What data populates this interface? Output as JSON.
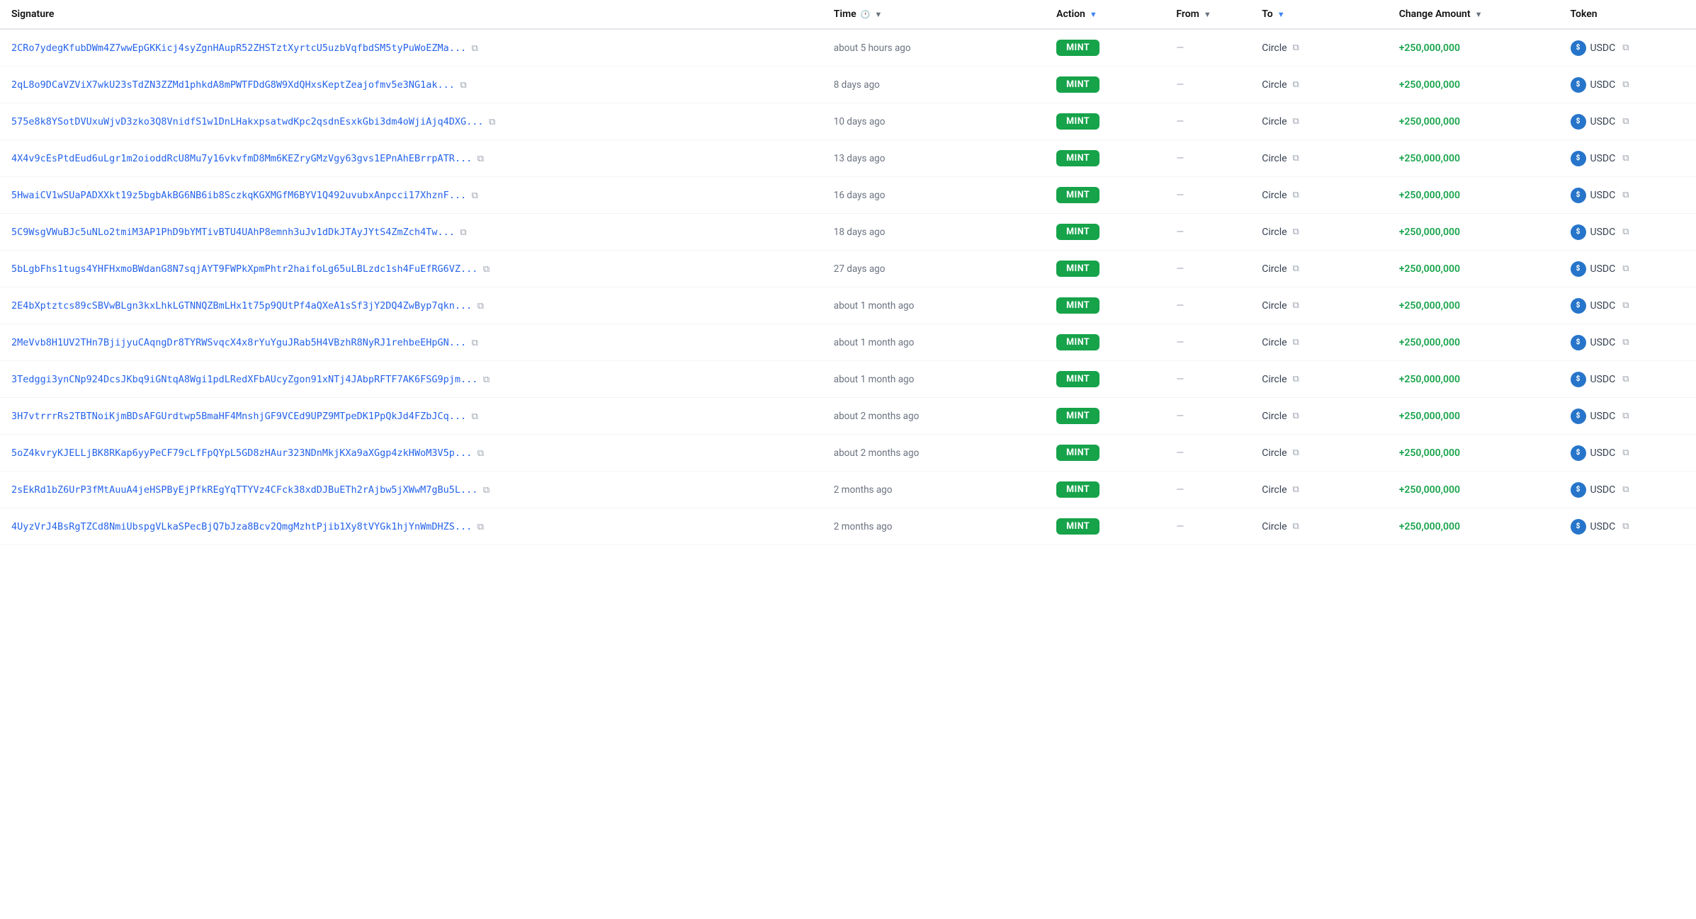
{
  "header": {
    "columns": {
      "signature": "Signature",
      "time": "Time",
      "action": "Action",
      "from": "From",
      "to": "To",
      "change_amount": "Change Amount",
      "token": "Token"
    }
  },
  "rows": [
    {
      "id": 1,
      "signature": "2CRo7ydegKfubDWm4Z7wwEpGKKicj4syZgnHAupR52ZHSTztXyrtcU5uzbVqfbdSM5tyPuWoEZMa...",
      "time": "about 5 hours ago",
      "action": "MINT",
      "from": "—",
      "to": "Circle",
      "amount": "+250,000,000",
      "token": "USDC"
    },
    {
      "id": 2,
      "signature": "2qL8o9DCaVZViX7wkU23sTdZN3ZZMd1phkdA8mPWTFDdG8W9XdQHxsKeptZeajofmv5e3NG1ak...",
      "time": "8 days ago",
      "action": "MINT",
      "from": "—",
      "to": "Circle",
      "amount": "+250,000,000",
      "token": "USDC"
    },
    {
      "id": 3,
      "signature": "575e8k8YSotDVUxuWjvD3zko3Q8VnidfS1w1DnLHakxpsatwdKpc2qsdnEsxkGbi3dm4oWjiAjq4DXG...",
      "time": "10 days ago",
      "action": "MINT",
      "from": "—",
      "to": "Circle",
      "amount": "+250,000,000",
      "token": "USDC"
    },
    {
      "id": 4,
      "signature": "4X4v9cEsPtdEud6uLgr1m2oioddRcU8Mu7y16vkvfmD8Mm6KEZryGMzVgy63gvs1EPnAhEBrrpATR...",
      "time": "13 days ago",
      "action": "MINT",
      "from": "—",
      "to": "Circle",
      "amount": "+250,000,000",
      "token": "USDC"
    },
    {
      "id": 5,
      "signature": "5HwaiCV1wSUaPADXXkt19z5bgbAkBG6NB6ib8SczkqKGXMGfM6BYV1Q492uvubxAnpcci17XhznF...",
      "time": "16 days ago",
      "action": "MINT",
      "from": "—",
      "to": "Circle",
      "amount": "+250,000,000",
      "token": "USDC"
    },
    {
      "id": 6,
      "signature": "5C9WsgVWuBJc5uNLo2tmiM3AP1PhD9bYMTivBTU4UAhP8emnh3uJv1dDkJTAyJYtS4ZmZch4Tw...",
      "time": "18 days ago",
      "action": "MINT",
      "from": "—",
      "to": "Circle",
      "amount": "+250,000,000",
      "token": "USDC"
    },
    {
      "id": 7,
      "signature": "5bLgbFhs1tugs4YHFHxmoBWdanG8N7sqjAYT9FWPkXpmPhtr2haifoLg65uLBLzdc1sh4FuEfRG6VZ...",
      "time": "27 days ago",
      "action": "MINT",
      "from": "—",
      "to": "Circle",
      "amount": "+250,000,000",
      "token": "USDC"
    },
    {
      "id": 8,
      "signature": "2E4bXptztcs89cSBVwBLgn3kxLhkLGTNNQZBmLHx1t75p9QUtPf4aQXeA1sSf3jY2DQ4ZwByp7qkn...",
      "time": "about 1 month ago",
      "action": "MINT",
      "from": "—",
      "to": "Circle",
      "amount": "+250,000,000",
      "token": "USDC"
    },
    {
      "id": 9,
      "signature": "2MeVvb8H1UV2THn7BjijyuCAqngDr8TYRWSvqcX4x8rYuYguJRab5H4VBzhR8NyRJ1rehbeEHpGN...",
      "time": "about 1 month ago",
      "action": "MINT",
      "from": "—",
      "to": "Circle",
      "amount": "+250,000,000",
      "token": "USDC"
    },
    {
      "id": 10,
      "signature": "3Tedggi3ynCNp924DcsJKbq9iGNtqA8Wgi1pdLRedXFbAUcyZgon91xNTj4JAbpRFTF7AK6FSG9pjm...",
      "time": "about 1 month ago",
      "action": "MINT",
      "from": "—",
      "to": "Circle",
      "amount": "+250,000,000",
      "token": "USDC"
    },
    {
      "id": 11,
      "signature": "3H7vtrrrRs2TBTNoiKjmBDsAFGUrdtwp5BmaHF4MnshjGF9VCEd9UPZ9MTpeDK1PpQkJd4FZbJCq...",
      "time": "about 2 months ago",
      "action": "MINT",
      "from": "—",
      "to": "Circle",
      "amount": "+250,000,000",
      "token": "USDC"
    },
    {
      "id": 12,
      "signature": "5oZ4kvryKJELLjBK8RKap6yyPeCF79cLfFpQYpL5GD8zHAur323NDnMkjKXa9aXGgp4zkHWoM3V5p...",
      "time": "about 2 months ago",
      "action": "MINT",
      "from": "—",
      "to": "Circle",
      "amount": "+250,000,000",
      "token": "USDC"
    },
    {
      "id": 13,
      "signature": "2sEkRd1bZ6UrP3fMtAuuA4jeHSPByEjPfkREgYqTTYVz4CFck38xdDJBuETh2rAjbw5jXWwM7gBu5L...",
      "time": "2 months ago",
      "action": "MINT",
      "from": "—",
      "to": "Circle",
      "amount": "+250,000,000",
      "token": "USDC"
    },
    {
      "id": 14,
      "signature": "4UyzVrJ4BsRgTZCd8NmiUbspgVLkaSPecBjQ7bJza8Bcv2QmgMzhtPjib1Xy8tVYGk1hjYnWmDHZS...",
      "time": "2 months ago",
      "action": "MINT",
      "from": "—",
      "to": "Circle",
      "amount": "+250,000,000",
      "token": "USDC"
    }
  ],
  "icons": {
    "copy": "⧉",
    "filter": "▼",
    "clock": "🕐",
    "usdc_letter": "$"
  }
}
